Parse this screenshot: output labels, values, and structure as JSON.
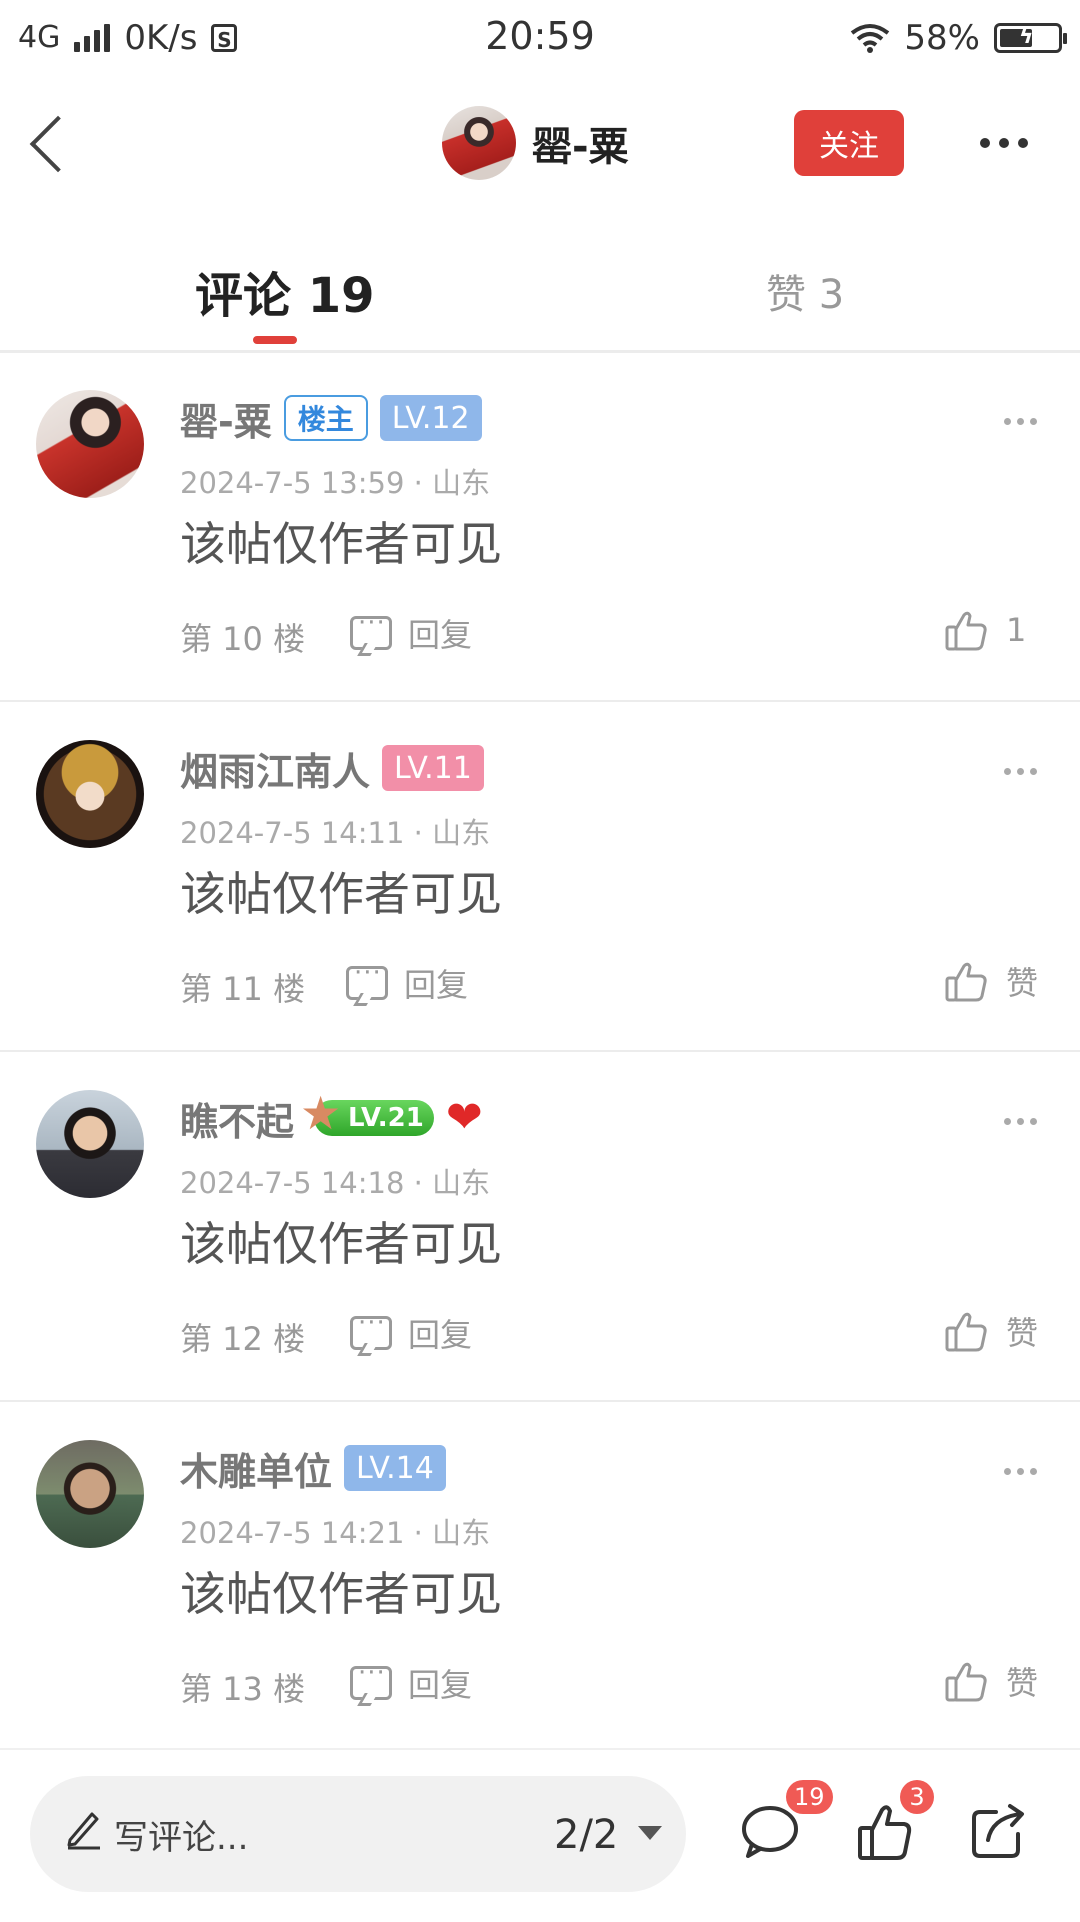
{
  "status_bar": {
    "network": "4G",
    "speed": "0K/s",
    "s_icon": "S",
    "time": "20:59",
    "battery_percent": "58%",
    "battery_level": 0.58
  },
  "header": {
    "author_name": "罂-粟",
    "follow_label": "关注"
  },
  "tabs": {
    "comments_label": "评论 19",
    "likes_label": "赞 3"
  },
  "comments": [
    {
      "name": "罂-粟",
      "owner_badge": "楼主",
      "level": "LV.12",
      "meta": "2024-7-5 13:59 · 山东",
      "text": "该帖仅作者可见",
      "floor": "第 10 楼",
      "reply_label": "回复",
      "like_label": "1"
    },
    {
      "name": "烟雨江南人",
      "level": "LV.11",
      "meta": "2024-7-5 14:11 · 山东",
      "text": "该帖仅作者可见",
      "floor": "第 11 楼",
      "reply_label": "回复",
      "like_label": "赞"
    },
    {
      "name": "瞧不起",
      "level": "LV.21",
      "meta": "2024-7-5 14:18 · 山东",
      "text": "该帖仅作者可见",
      "floor": "第 12 楼",
      "reply_label": "回复",
      "like_label": "赞"
    },
    {
      "name": "木雕单位",
      "level": "LV.14",
      "meta": "2024-7-5 14:21 · 山东",
      "text": "该帖仅作者可见",
      "floor": "第 13 楼",
      "reply_label": "回复",
      "like_label": "赞"
    }
  ],
  "bottom_bar": {
    "input_placeholder": "写评论...",
    "pager": "2/2",
    "comment_count": "19",
    "like_count": "3"
  },
  "icons": {
    "back": "chevron-left-icon",
    "more": "more-horizontal-icon",
    "reply": "comment-bubble-icon",
    "like": "thumbs-up-icon",
    "edit": "pencil-icon",
    "share": "share-icon",
    "heart": "heart-handshake-icon"
  },
  "colors": {
    "accent": "#e0403a",
    "owner_badge": "#3388dd",
    "level_blue": "#8fb7ea",
    "level_pink": "#f28fa8",
    "level_green": "#2fa62a",
    "badge_red": "#f05a55"
  }
}
